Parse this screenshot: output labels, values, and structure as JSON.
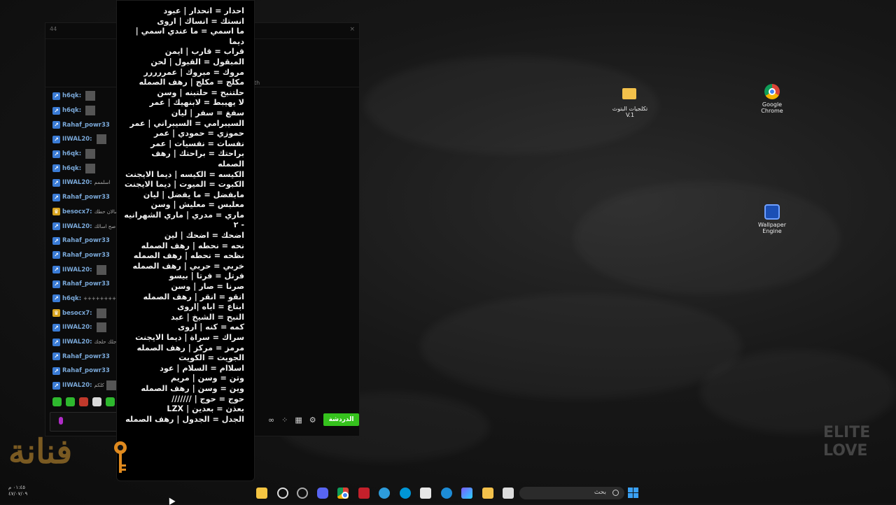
{
  "chat": {
    "window_number": "44",
    "close_label": "×",
    "header_fragment": "th",
    "messages": [
      {
        "name": "h6qk:",
        "badge": "arrow",
        "extra": "",
        "thumb": true
      },
      {
        "name": "h6qk:",
        "badge": "arrow",
        "extra": "",
        "thumb": true
      },
      {
        "name": "Rahaf_powr33",
        "badge": "arrow",
        "extra": "",
        "thumb": false
      },
      {
        "name": "IIWAL20:",
        "badge": "arrow",
        "extra": "",
        "thumb": true
      },
      {
        "name": "h6qk:",
        "badge": "arrow",
        "extra": "",
        "thumb": true
      },
      {
        "name": "h6qk:",
        "badge": "arrow",
        "extra": "",
        "thumb": true
      },
      {
        "name": "IIWAL20:",
        "badge": "arrow",
        "extra": "اسلممم",
        "thumb": false
      },
      {
        "name": "Rahaf_powr33",
        "badge": "arrow",
        "extra": "",
        "thumb": false
      },
      {
        "name": "besocx7:",
        "badge": "crown",
        "extra": "سالان حطك",
        "thumb": false
      },
      {
        "name": "IIWAL20:",
        "badge": "arrow",
        "extra": "صح اسالك",
        "thumb": false
      },
      {
        "name": "Rahaf_powr33",
        "badge": "arrow",
        "extra": "",
        "thumb": false
      },
      {
        "name": "Rahaf_powr33",
        "badge": "arrow",
        "extra": "",
        "thumb": false
      },
      {
        "name": "IIWAL20:",
        "badge": "arrow",
        "extra": "",
        "thumb": true
      },
      {
        "name": "Rahaf_powr33",
        "badge": "arrow",
        "extra": "",
        "thumb": false
      },
      {
        "name": "h6qk:",
        "badge": "arrow",
        "extra": "+++++++++",
        "thumb": false
      },
      {
        "name": "besocx7:",
        "badge": "crown",
        "extra": "",
        "thumb": true
      },
      {
        "name": "IIWAL20:",
        "badge": "arrow",
        "extra": "",
        "thumb": true
      },
      {
        "name": "IIWAL20:",
        "badge": "arrow",
        "extra": "لم اجلك حلجك",
        "thumb": false
      },
      {
        "name": "Rahaf_powr33",
        "badge": "arrow",
        "extra": "",
        "thumb": false
      },
      {
        "name": "Rahaf_powr33",
        "badge": "arrow",
        "extra": "",
        "thumb": false
      },
      {
        "name": "IIWAL20:",
        "badge": "arrow",
        "extra": "كلكم",
        "thumb": true
      }
    ],
    "send_label": "الدردشة",
    "bottom_icon_colors": [
      "#2eb82e",
      "#2eb82e",
      "#c0392b",
      "#d9d9d9",
      "#2eb82e"
    ]
  },
  "note": {
    "lines": [
      "احدار = انحدار | عبود",
      "انستك = انساك | اروى",
      "ما اسمي = ما عندي اسمي | ديما",
      "قراب = قارب | ايمن",
      "المبقول = القبول | لحن",
      "مروك = مبروك | عمررررر",
      "مكلج = مكلج | رهف الصمله",
      "حلتنبح = حلتبنه | وسن",
      "لا يهيبط = لابنهيك | عمر",
      "سفغ = سفر | ليان",
      "السيبرامي = السيبراني | عمر",
      "حموزي = حمودي | عمر",
      "نفسات = نفسيات | عمر",
      "براحتك = براحتك | رهف الصمله",
      "الكيسه = الكيسه | ديما الايجنت",
      "الكبوت = الميوت | ديما الايجنت",
      "مابفضل = ما يفضل | ليان",
      "معلبس = معليش | وسن",
      "ماري = مدري | ماري الشهرانيه - ٢",
      "اضحك = اضحك | لين",
      "نحه = نحطه | رهف الصمله",
      "نظحه = نحطه | رهف الصمله",
      "خربي = حربي | رهف الصمله",
      "فرتل = فرتا | بيسو",
      "صرنا = صار | وسن",
      "انقو = انقر | رهف الصمله",
      "ابناع = اباه |اروى",
      "النبح = الشيخ | عبد",
      "كمه = كنه | اروى",
      "سراك = سراة | ديما الايجنت",
      "مرمز = مركز | رهف الصمله",
      "الجويت = الكويت",
      "اسلاام = السلام | عود",
      "وتن = وسن | مريم",
      "وين = وسن | رهف الصمله",
      "حوج = حوج | ///////",
      "بعذن = بعدين | LZX",
      "الجدل = الجدول | رهف الصمله"
    ]
  },
  "desktop": {
    "icons": [
      {
        "id": "folder",
        "label": "تكلجيات البتوث V.1"
      },
      {
        "id": "chrome",
        "label": "Google Chrome"
      },
      {
        "id": "wallpaper",
        "label": "Wallpaper Engine"
      }
    ],
    "logo_left": "فنانة",
    "logo_right": "ELITE LOVE"
  },
  "taskbar": {
    "search_placeholder": "بحث",
    "clock_time": "٠١:٤٥ م",
    "clock_date": "٤٧/٠٧/٠٩"
  }
}
